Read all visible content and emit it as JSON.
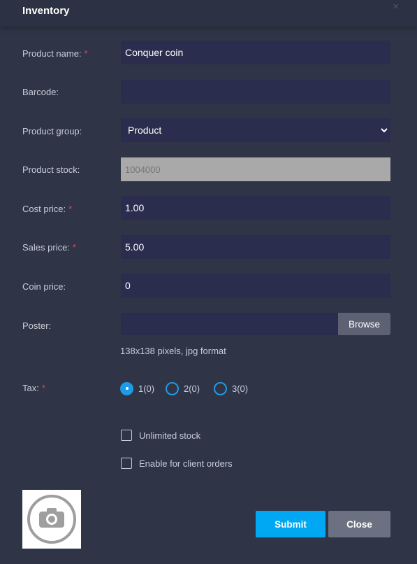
{
  "header": {
    "title": "Inventory",
    "close_glyph": "×"
  },
  "required_marker": "*",
  "form": {
    "product_name": {
      "label": "Product name:",
      "value": "Conquer coin"
    },
    "barcode": {
      "label": "Barcode:",
      "value": ""
    },
    "product_group": {
      "label": "Product group:",
      "value": "Product"
    },
    "product_stock": {
      "label": "Product stock:",
      "placeholder": "1004000"
    },
    "cost_price": {
      "label": "Cost price:",
      "value": "1.00"
    },
    "sales_price": {
      "label": "Sales price:",
      "value": "5.00"
    },
    "coin_price": {
      "label": "Coin price:",
      "value": "0"
    },
    "poster": {
      "label": "Poster:",
      "browse_label": "Browse",
      "hint": "138x138 pixels, jpg format"
    },
    "tax": {
      "label": "Tax:",
      "options": [
        {
          "label": "1(0)",
          "checked": true
        },
        {
          "label": "2(0)",
          "checked": false
        },
        {
          "label": "3(0)",
          "checked": false
        }
      ]
    },
    "unlimited_stock": {
      "label": "Unlimited stock",
      "checked": false
    },
    "client_orders": {
      "label": "Enable for client orders",
      "checked": false
    }
  },
  "actions": {
    "submit_label": "Submit",
    "close_label": "Close"
  },
  "icons": {
    "photo": "camera-icon",
    "dropdown": "chevron-down-icon",
    "close": "close-icon"
  },
  "colors": {
    "accent": "#00a8f3",
    "radio": "#1e9be6",
    "required": "#e0474c",
    "field_bg": "#2a2d4d"
  }
}
